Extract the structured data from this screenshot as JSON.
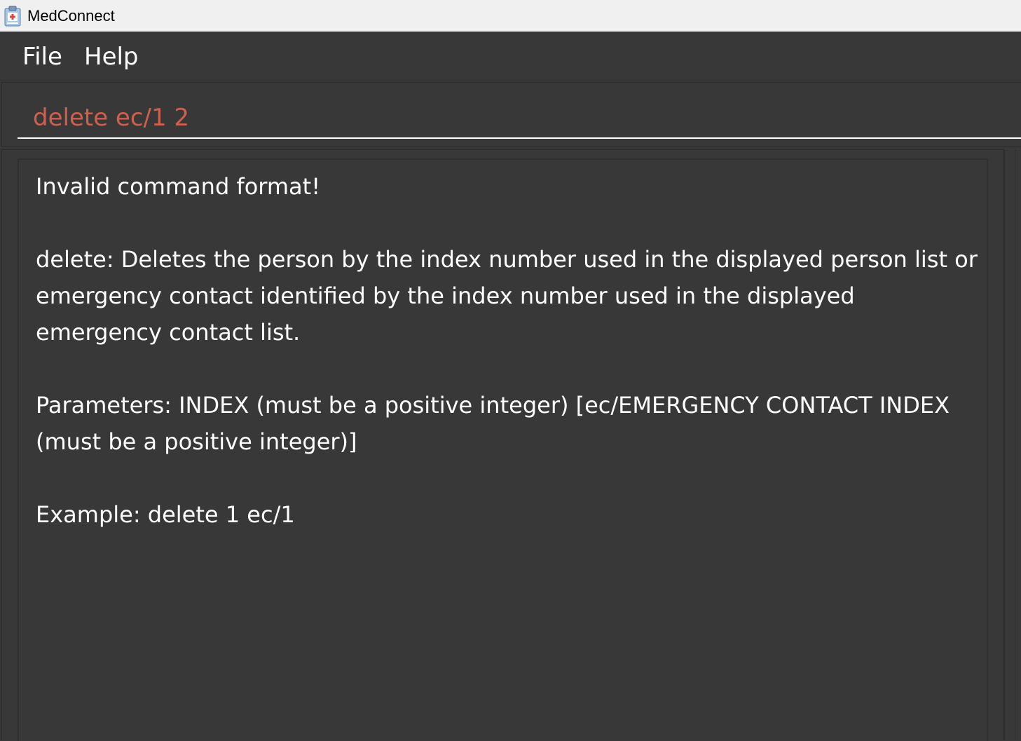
{
  "window": {
    "title": "MedConnect",
    "icon": "medical-clipboard-icon"
  },
  "menubar": {
    "items": [
      {
        "label": "File"
      },
      {
        "label": "Help"
      }
    ]
  },
  "command_box": {
    "value": "delete ec/1 2",
    "text_color": "#d0604e"
  },
  "result_display": {
    "text": "Invalid command format!\n\ndelete: Deletes the person by the index number used in the displayed person list or emergency contact identified by the index number used in the displayed emergency contact list.\n\nParameters: INDEX (must be a positive integer) [ec/EMERGENCY CONTACT INDEX (must be a positive integer)]\n\nExample: delete 1 ec/1"
  },
  "colors": {
    "background": "#383838",
    "titlebar": "#f0f0f0",
    "text": "#ffffff",
    "error_text": "#d0604e"
  }
}
